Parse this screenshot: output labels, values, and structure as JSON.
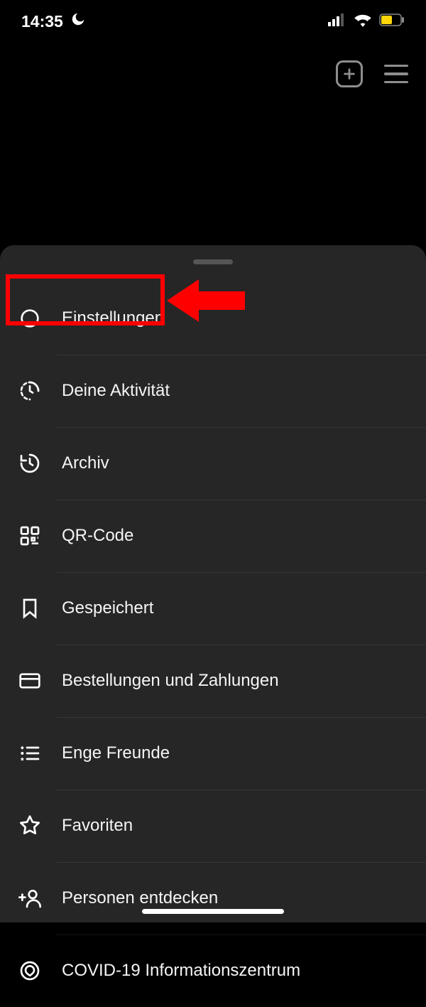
{
  "statusbar": {
    "time": "14:35"
  },
  "menu": {
    "items": [
      {
        "icon": "gear-icon",
        "label": "Einstellungen"
      },
      {
        "icon": "activity-icon",
        "label": "Deine Aktivität"
      },
      {
        "icon": "archive-icon",
        "label": "Archiv"
      },
      {
        "icon": "qr-icon",
        "label": "QR-Code"
      },
      {
        "icon": "bookmark-icon",
        "label": "Gespeichert"
      },
      {
        "icon": "card-icon",
        "label": "Bestellungen und Zahlungen"
      },
      {
        "icon": "close-friends-icon",
        "label": "Enge Freunde"
      },
      {
        "icon": "star-icon",
        "label": "Favoriten"
      },
      {
        "icon": "add-person-icon",
        "label": "Personen entdecken"
      },
      {
        "icon": "covid-icon",
        "label": "COVID-19 Informationszentrum"
      }
    ]
  },
  "annotation": {
    "highlightIndex": 0
  }
}
